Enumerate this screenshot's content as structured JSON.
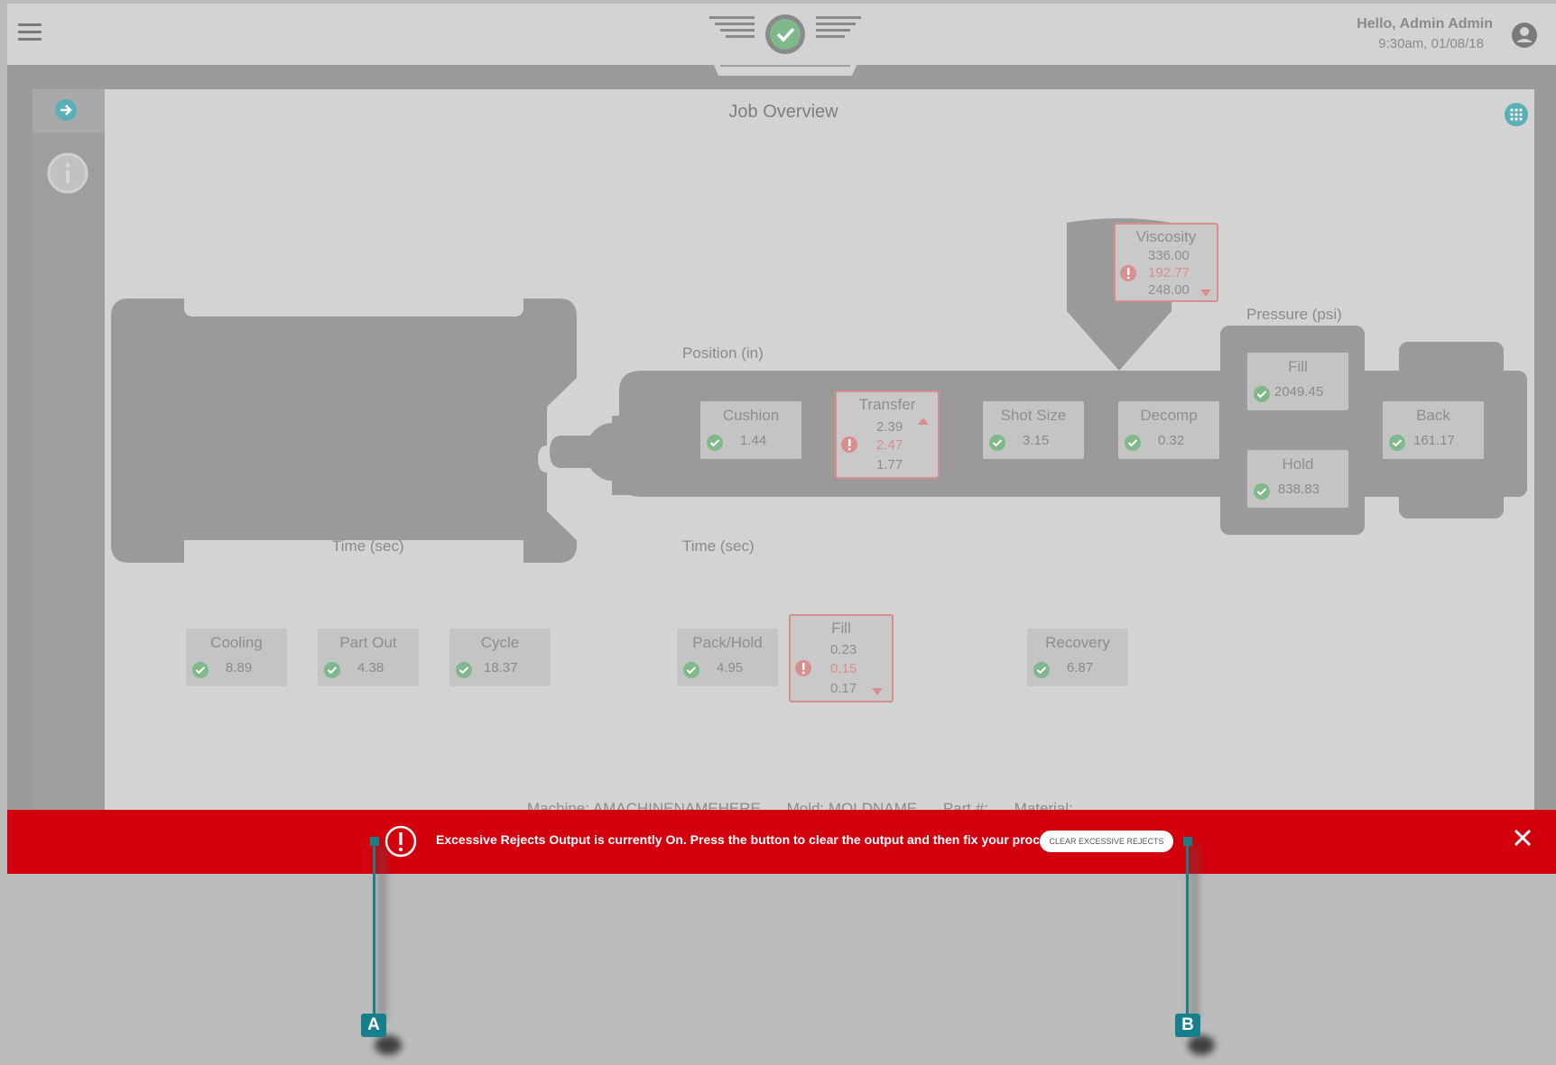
{
  "header": {
    "greeting": "Hello, Admin Admin",
    "timestamp": "9:30am, 01/08/18"
  },
  "page": {
    "title": "Job Overview"
  },
  "sections": {
    "position_label": "Position (in)",
    "pressure_label": "Pressure (psi)",
    "time_left_label": "Time (sec)",
    "time_right_label": "Time (sec)"
  },
  "metrics": {
    "viscosity": {
      "name": "Viscosity",
      "upper": "336.00",
      "value": "192.77",
      "lower": "248.00"
    },
    "cushion": {
      "name": "Cushion",
      "value": "1.44"
    },
    "transfer": {
      "name": "Transfer",
      "upper": "2.39",
      "value": "2.47",
      "lower": "1.77"
    },
    "shot_size": {
      "name": "Shot Size",
      "value": "3.15"
    },
    "decomp": {
      "name": "Decomp",
      "value": "0.32"
    },
    "fill_pressure": {
      "name": "Fill",
      "value": "2049.45"
    },
    "hold_pressure": {
      "name": "Hold",
      "value": "838.83"
    },
    "back_pressure": {
      "name": "Back",
      "value": "161.17"
    },
    "cooling": {
      "name": "Cooling",
      "value": "8.89"
    },
    "part_out": {
      "name": "Part Out",
      "value": "4.38"
    },
    "cycle": {
      "name": "Cycle",
      "value": "18.37"
    },
    "pack_hold": {
      "name": "Pack/Hold",
      "value": "4.95"
    },
    "fill_time": {
      "name": "Fill",
      "upper": "0.23",
      "value": "0.15",
      "lower": "0.17"
    },
    "recovery": {
      "name": "Recovery",
      "value": "6.87"
    }
  },
  "footer": {
    "machine": "Machine: AMACHINENAMEHERE",
    "mold": "Mold: MOLDNAME",
    "part": "Part #:",
    "material": "Material:"
  },
  "banner": {
    "message": "Excessive Rejects Output is currently On. Press the button to clear the output and then fix your process.",
    "button_label": "CLEAR EXCESSIVE REJECTS",
    "color": "#d3000d"
  },
  "callouts": {
    "a": "A",
    "b": "B"
  },
  "colors": {
    "ok_green": "#7fb98b",
    "alert_red": "#d98e8e",
    "callout_teal": "#157f8b"
  }
}
